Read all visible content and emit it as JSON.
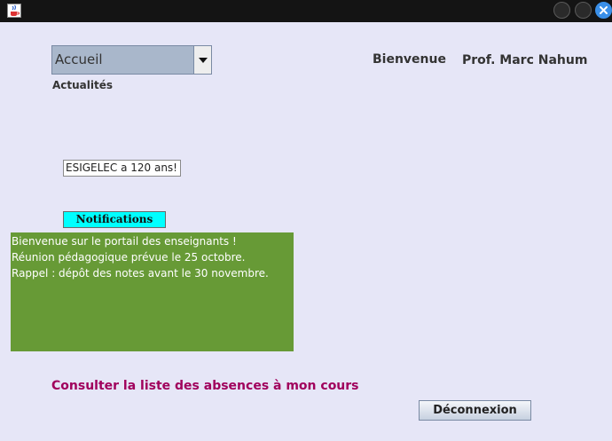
{
  "window": {
    "icon": "java-cup-icon",
    "controls": [
      "minimize-icon",
      "maximize-icon",
      "close-icon"
    ]
  },
  "nav": {
    "selected": "Accueil"
  },
  "news": {
    "title": "Actualités",
    "headline": "ESIGELEC a 120 ans!"
  },
  "header": {
    "welcome": "Bienvenue",
    "user": "Prof. Marc Nahum"
  },
  "notifications": {
    "button_label": "Notifications",
    "lines": [
      "Bienvenue sur le portail des enseignants !",
      "Réunion pédagogique prévue le 25 octobre.",
      "Rappel : dépôt des notes avant le 30 novembre."
    ]
  },
  "actions": {
    "absences_link": "Consulter la liste des absences à mon cours",
    "logout": "Déconnexion"
  },
  "colors": {
    "background": "#e6e6f7",
    "notifications_button": "#00ffff",
    "notifications_panel": "#679a36",
    "link": "#a0005c"
  }
}
